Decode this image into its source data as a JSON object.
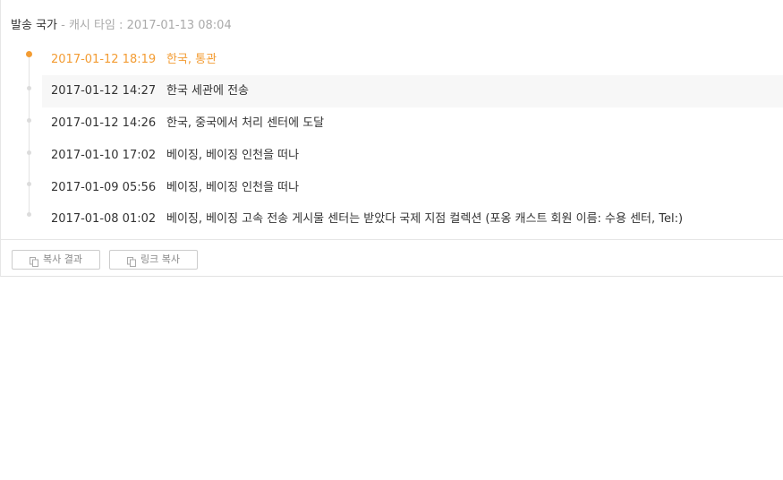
{
  "header": {
    "country": "발송 국가",
    "separator": " - ",
    "cache_time": "캐시 타임 : 2017-01-13 08:04"
  },
  "events": [
    {
      "time": "2017-01-12 18:19",
      "text": "한국, 통관"
    },
    {
      "time": "2017-01-12 14:27",
      "text": "한국 세관에 전송"
    },
    {
      "time": "2017-01-12 14:26",
      "text": "한국, 중국에서 처리 센터에 도달"
    },
    {
      "time": "2017-01-10 17:02",
      "text": "베이징, 베이징 인천을 떠나"
    },
    {
      "time": "2017-01-09 05:56",
      "text": "베이징, 베이징 인천을 떠나"
    },
    {
      "time": "2017-01-08 01:02",
      "text": "베이징, 베이징 고속 전송 게시물 센터는 받았다 국제 지점 컬렉션 (포옹 캐스트 회원 이름: 수용 센터, Tel:)"
    }
  ],
  "actions": {
    "copy_result": "복사 결과",
    "copy_link": "링크 복사",
    "icon": "copy-icon"
  },
  "colors": {
    "accent": "#f39c33",
    "muted": "#aaaaaa",
    "text": "#333333"
  }
}
